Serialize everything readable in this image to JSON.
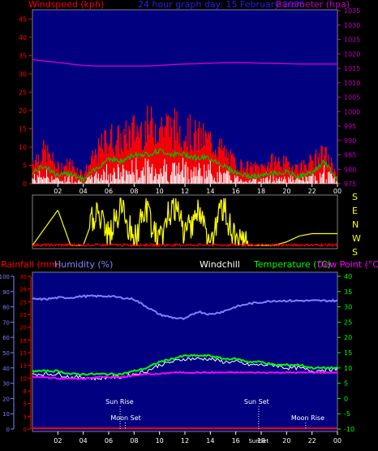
{
  "header": {
    "windspeed_label": "Windspeed (kph)",
    "date_label": "24 hour graph day: 15 February 2005",
    "barometer_label": "Barometer (hpa)"
  },
  "lower_header": {
    "rainfall_label": "Rainfall (mm)",
    "humidity_label": "Humidity (%)",
    "windchill_label": "Windchill",
    "temperature_label": "Temperature (°C)",
    "dewpoint_label": "Dew Point (°C)"
  },
  "colors": {
    "background": "#000000",
    "panel": "#000080",
    "wind_gust": "#ff0000",
    "wind_avg": "#00c000",
    "wind_low": "#ffffff",
    "barometer": "#c000c0",
    "direction": "#ffff00",
    "direction_low": "#ff0000",
    "humidity": "#8080ff",
    "temperature": "#00ff00",
    "dewpoint": "#ff00ff",
    "windchill": "#ffffff",
    "rain": "#ff0000"
  },
  "x_ticks": [
    "02",
    "04",
    "06",
    "08",
    "10",
    "12",
    "14",
    "16",
    "18",
    "20",
    "22",
    "00"
  ],
  "wind_axis": [
    "0",
    "5",
    "10",
    "15",
    "20",
    "25",
    "30",
    "35",
    "40",
    "45"
  ],
  "baro_axis": [
    "975",
    "980",
    "985",
    "990",
    "995",
    "1000",
    "1005",
    "1010",
    "1015",
    "1020",
    "1025",
    "1030",
    "1035"
  ],
  "direction_labels": [
    "S",
    "E",
    "N",
    "W",
    "S"
  ],
  "humidity_axis": [
    "0",
    "10",
    "20",
    "30",
    "40",
    "50",
    "60",
    "70",
    "80",
    "90",
    "100"
  ],
  "rain_axis": [
    "0",
    "3",
    "5",
    "8",
    "10",
    "13",
    "15",
    "18",
    "20",
    "23",
    "25",
    "28",
    "30"
  ],
  "temp_axis": [
    "-10",
    "-5",
    "0",
    "5",
    "10",
    "15",
    "20",
    "25",
    "30",
    "35",
    "40"
  ],
  "events": {
    "sunrise": "Sun Rise",
    "moonset": "Moon Set",
    "sunset": "Sun Set",
    "moonrise": "Moon Rise",
    "sunset_axis_tag": "SunSet"
  },
  "chart_data": [
    {
      "type": "area",
      "title": "24 hour graph day: 15 February 2005",
      "ylabel": "Windspeed (kph)",
      "ylim": [
        0,
        45
      ],
      "y2label": "Barometer (hpa)",
      "y2lim": [
        975,
        1035
      ],
      "x": [
        0,
        1,
        2,
        3,
        4,
        5,
        6,
        7,
        8,
        9,
        10,
        11,
        12,
        13,
        14,
        15,
        16,
        17,
        18,
        19,
        20,
        21,
        22,
        23,
        24
      ],
      "series": [
        {
          "name": "gust",
          "values": [
            7,
            10,
            5,
            6,
            3,
            9,
            14,
            13,
            16,
            17,
            18,
            17,
            16,
            14,
            13,
            10,
            6,
            5,
            5,
            7,
            6,
            5,
            7,
            9,
            3
          ]
        },
        {
          "name": "average",
          "values": [
            3,
            5,
            2,
            3,
            1,
            4,
            7,
            6,
            8,
            8,
            9,
            8,
            8,
            7,
            7,
            5,
            3,
            2,
            2,
            3,
            3,
            2,
            3,
            6,
            1
          ]
        },
        {
          "name": "barometer",
          "values": [
            1018,
            1017.5,
            1017,
            1016.5,
            1016,
            1015.8,
            1015.8,
            1015.8,
            1015.8,
            1015.8,
            1016,
            1016.3,
            1016.5,
            1016.6,
            1016.8,
            1016.9,
            1017,
            1016.9,
            1016.8,
            1016.7,
            1016.6,
            1016.5,
            1016.5,
            1016.5,
            1016.5
          ]
        }
      ]
    },
    {
      "type": "line",
      "title": "",
      "ylabel": "",
      "x": [
        0,
        1,
        2,
        3,
        4,
        5,
        6,
        7,
        8,
        9,
        10,
        11,
        12,
        13,
        14,
        15,
        16,
        17,
        18,
        19,
        20,
        21,
        22,
        23,
        24
      ],
      "series": [
        {
          "name": "direction",
          "values": [
            4.0,
            2.5,
            1.0,
            4.0,
            4.0,
            1.0,
            3.5,
            0.5,
            3.5,
            1.0,
            4.0,
            0.5,
            3.0,
            1.0,
            4.0,
            0.5,
            4.0,
            4.0,
            4.0,
            4.0,
            3.7,
            3.2,
            3.0,
            3.0,
            3.0
          ]
        }
      ]
    },
    {
      "type": "line",
      "title": "",
      "ylabel": "Humidity (%)",
      "ylim": [
        0,
        100
      ],
      "y2label": "Temperature (°C)",
      "y2lim": [
        -10,
        40
      ],
      "x": [
        0,
        1,
        2,
        3,
        4,
        5,
        6,
        7,
        8,
        9,
        10,
        11,
        12,
        13,
        14,
        15,
        16,
        17,
        18,
        19,
        20,
        21,
        22,
        23,
        24
      ],
      "series": [
        {
          "name": "Humidity (%)",
          "values": [
            85,
            85,
            86,
            86,
            87,
            87,
            87,
            86,
            85,
            80,
            75,
            73,
            72,
            77,
            75,
            77,
            80,
            82,
            83,
            84,
            84,
            84,
            84,
            84,
            84
          ]
        },
        {
          "name": "Temperature (°C)",
          "values": [
            9,
            9,
            9,
            8,
            8,
            8,
            8,
            8,
            9,
            10,
            12,
            13,
            14,
            14,
            14,
            13,
            13,
            12,
            12,
            11,
            11,
            11,
            10,
            10,
            10
          ]
        },
        {
          "name": "Dew Point (°C)",
          "values": [
            7,
            7,
            6.5,
            6.5,
            6.5,
            7,
            7,
            7,
            7.5,
            8,
            8,
            8.5,
            8.5,
            8.5,
            8.5,
            8.5,
            8.5,
            8.5,
            8.5,
            8.5,
            8.5,
            8.5,
            8.5,
            8.5,
            8.5
          ]
        },
        {
          "name": "Windchill",
          "values": [
            8,
            8,
            8,
            7,
            7,
            6.5,
            7,
            7,
            8,
            9,
            11,
            12,
            13,
            13,
            13,
            12,
            12,
            11,
            11,
            11,
            10,
            10,
            9,
            9.5,
            9.5
          ]
        },
        {
          "name": "Rainfall (mm)",
          "values": [
            0,
            0,
            0,
            0,
            0,
            0,
            0,
            0,
            0,
            0,
            0,
            0,
            0,
            0,
            0,
            0,
            0,
            0,
            0,
            0,
            0,
            0,
            0,
            0,
            0
          ]
        }
      ]
    }
  ]
}
